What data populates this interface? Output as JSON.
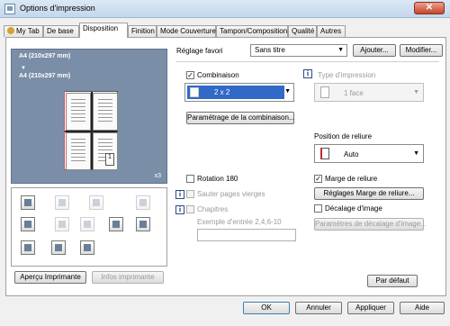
{
  "window": {
    "title": "Options d'impression",
    "close_label": "✕"
  },
  "tabs": [
    {
      "label": "My Tab"
    },
    {
      "label": "De base"
    },
    {
      "label": "Disposition"
    },
    {
      "label": "Finition"
    },
    {
      "label": "Mode Couverture"
    },
    {
      "label": "Tampon/Composition"
    },
    {
      "label": "Qualité"
    },
    {
      "label": "Autres"
    }
  ],
  "active_tab": "Disposition",
  "preview": {
    "original_size": "A4 (210x297 mm)",
    "output_size": "A4 (210x297 mm)",
    "copies": "x3",
    "page_number": "1"
  },
  "buttons": {
    "apercu": "Aperçu Imprimante",
    "infos": "Infos imprimante",
    "ajouter": "Ajouter...",
    "modifier": "Modifier...",
    "parametrage_combinaison": "Paramétrage de la combinaison...",
    "reglages_marge": "Réglages Marge de reliure...",
    "parametres_decalage": "Paramètres de décalage d'image...",
    "par_defaut": "Par défaut",
    "ok": "OK",
    "annuler": "Annuler",
    "appliquer": "Appliquer",
    "aide": "Aide"
  },
  "favorite": {
    "label": "Réglage favori",
    "value": "Sans titre"
  },
  "combinaison": {
    "label": "Combinaison",
    "checked": true,
    "value": "2 x 2"
  },
  "type_impression": {
    "label": "Type d'impression",
    "value": "1 face",
    "disabled": true
  },
  "position_reliure": {
    "label": "Position de reliure",
    "value": "Auto"
  },
  "rotation": {
    "label": "Rotation 180",
    "checked": false
  },
  "sauter_pages": {
    "label": "Sauter pages vierges",
    "checked": false,
    "disabled": true
  },
  "chapitres": {
    "label": "Chapitres",
    "checked": false,
    "disabled": true,
    "example": "Exemple d'entrée 2,4,6-10",
    "value": ""
  },
  "marge_reliure": {
    "label": "Marge de reliure",
    "checked": true
  },
  "decalage_image": {
    "label": "Décalage d'image",
    "checked": false
  },
  "icons": [
    "combine-icon",
    "rotate-icon",
    "duplex-icon",
    "booklet-icon",
    "chapter-icon",
    "cover-icon",
    "insert-icon",
    "margin-icon",
    "staple-icon",
    "punch-icon",
    "user-icon",
    "stamp-icon"
  ]
}
